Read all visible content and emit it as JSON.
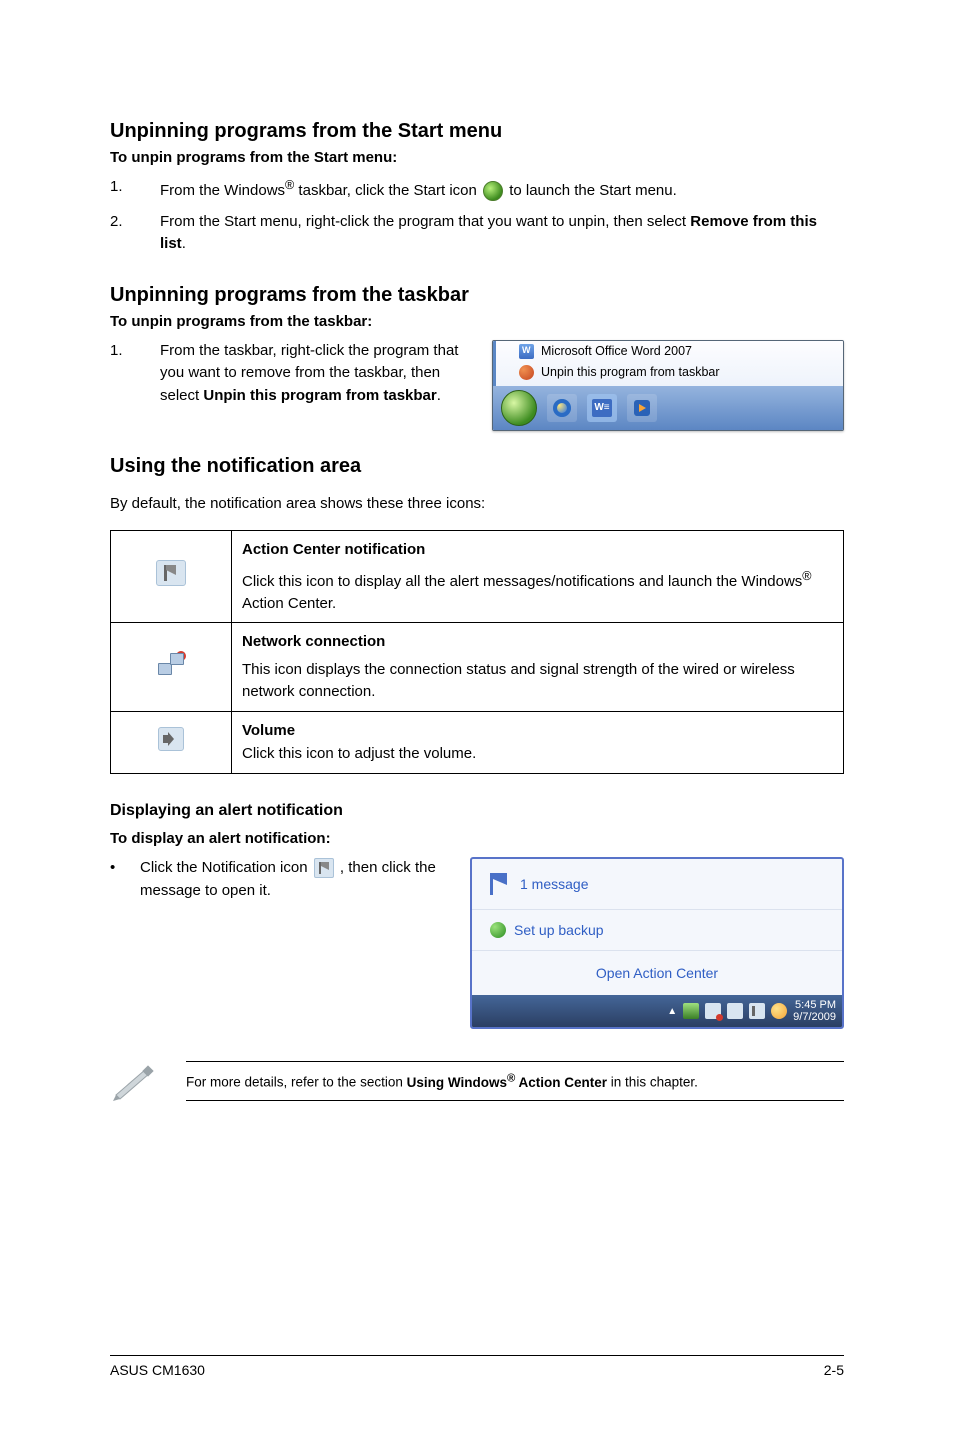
{
  "sections": {
    "unpin_start": {
      "title": "Unpinning programs from the Start menu",
      "subtitle": "To unpin programs from the Start menu:",
      "step1_a": "From the Windows",
      "step1_b": " taskbar, click the Start icon ",
      "step1_c": " to launch the Start menu.",
      "step2_a": "From the Start menu, right-click the program that you want to unpin, then select ",
      "step2_b": "Remove from this list",
      "step2_c": "."
    },
    "unpin_taskbar": {
      "title": "Unpinning programs from the taskbar",
      "subtitle": "To unpin programs from the taskbar:",
      "step1_a": "From the taskbar, right-click the program that you want to remove from the taskbar, then select ",
      "step1_b": "Unpin this program from taskbar",
      "step1_c": "."
    },
    "notif_area": {
      "title": "Using the notification area",
      "intro": "By default, the notification area shows these three icons:",
      "rows": {
        "action": {
          "title": "Action Center notification",
          "desc_a": "Click this icon to display all the alert messages/notifications and launch the Windows",
          "desc_b": " Action Center."
        },
        "network": {
          "title": "Network connection",
          "desc": "This icon displays the connection status and signal strength of the wired or wireless network connection."
        },
        "volume": {
          "title": "Volume",
          "desc": "Click this icon to adjust the volume."
        }
      }
    },
    "alert": {
      "title": "Displaying an alert notification",
      "subtitle": "To display an alert notification:",
      "step_a": "Click the Notification icon ",
      "step_b": ", then click the message to open it."
    },
    "note": {
      "text_a": "For more details, refer to the section ",
      "text_b": "Using Windows",
      "text_c": " Action Center",
      "text_d": " in this chapter."
    }
  },
  "jumplist": {
    "row1": "Microsoft Office Word 2007",
    "row2": "Unpin this program from taskbar"
  },
  "alert_panel": {
    "messages": "1 message",
    "setup": "Set up backup",
    "open": "Open Action Center",
    "time": "5:45 PM",
    "date": "9/7/2009"
  },
  "footer": {
    "left": "ASUS CM1630",
    "right": "2-5"
  },
  "list_numbers": {
    "one": "1.",
    "two": "2.",
    "bullet": "•"
  },
  "reg_mark": "®"
}
